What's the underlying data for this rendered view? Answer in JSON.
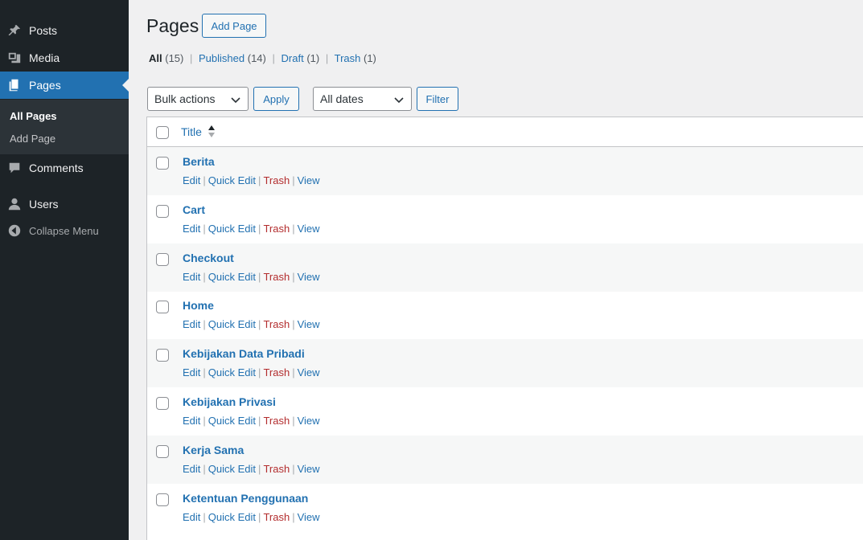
{
  "sidebar": {
    "items": [
      {
        "label": "Posts",
        "icon": "pin-icon"
      },
      {
        "label": "Media",
        "icon": "media-icon"
      },
      {
        "label": "Pages",
        "icon": "pages-icon",
        "current": true
      },
      {
        "label": "Comments",
        "icon": "comment-icon"
      },
      {
        "label": "Users",
        "icon": "user-icon"
      }
    ],
    "submenu": [
      {
        "label": "All Pages",
        "current": true
      },
      {
        "label": "Add Page"
      }
    ],
    "collapse_label": "Collapse Menu"
  },
  "header": {
    "title": "Pages",
    "add_button": "Add Page"
  },
  "filters": {
    "views": [
      {
        "label": "All",
        "count": "(15)"
      },
      {
        "label": "Published",
        "count": "(14)"
      },
      {
        "label": "Draft",
        "count": "(1)"
      },
      {
        "label": "Trash",
        "count": "(1)"
      }
    ],
    "separator": "|",
    "bulk_select": "Bulk actions",
    "apply_button": "Apply",
    "dates_select": "All dates",
    "filter_button": "Filter"
  },
  "table": {
    "column_title": "Title",
    "row_actions": [
      "Edit",
      "Quick Edit",
      "Trash",
      "View"
    ],
    "rows": [
      {
        "title": "Berita"
      },
      {
        "title": "Cart"
      },
      {
        "title": "Checkout"
      },
      {
        "title": "Home"
      },
      {
        "title": "Kebijakan Data Pribadi"
      },
      {
        "title": "Kebijakan Privasi"
      },
      {
        "title": "Kerja Sama"
      },
      {
        "title": "Ketentuan Penggunaan"
      }
    ]
  },
  "colors": {
    "sidebar_bg": "#1d2327",
    "accent": "#2271b1",
    "trash": "#b32d2e"
  }
}
